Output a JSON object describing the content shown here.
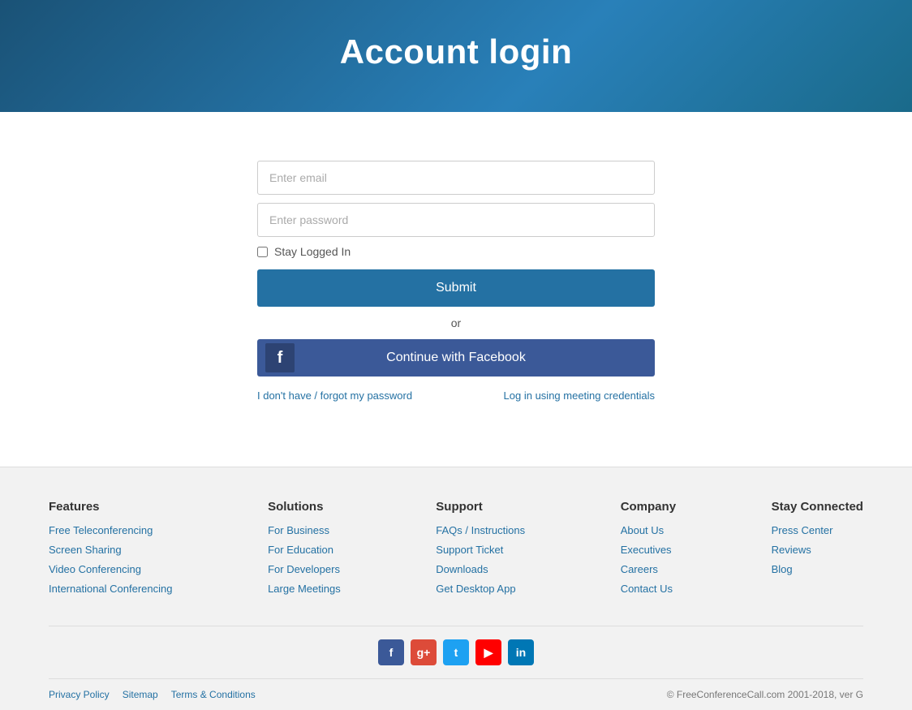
{
  "header": {
    "title": "Account login"
  },
  "form": {
    "email_placeholder": "Enter email",
    "password_placeholder": "Enter password",
    "stay_logged_in_label": "Stay Logged In",
    "submit_label": "Submit",
    "or_text": "or",
    "facebook_button_label": "Continue with Facebook",
    "forgot_password_link": "I don't have / forgot my password",
    "meeting_credentials_link": "Log in using meeting credentials"
  },
  "footer": {
    "columns": [
      {
        "heading": "Features",
        "links": [
          "Free Teleconferencing",
          "Screen Sharing",
          "Video Conferencing",
          "International Conferencing"
        ]
      },
      {
        "heading": "Solutions",
        "links": [
          "For Business",
          "For Education",
          "For Developers",
          "Large Meetings"
        ]
      },
      {
        "heading": "Support",
        "links": [
          "FAQs / Instructions",
          "Support Ticket",
          "Downloads",
          "Get Desktop App"
        ]
      },
      {
        "heading": "Company",
        "links": [
          "About Us",
          "Executives",
          "Careers",
          "Contact Us"
        ]
      },
      {
        "heading": "Stay Connected",
        "links": [
          "Press Center",
          "Reviews",
          "Blog"
        ]
      }
    ],
    "bottom": {
      "privacy_policy": "Privacy Policy",
      "sitemap": "Sitemap",
      "terms": "Terms & Conditions",
      "copyright": "© FreeConferenceCall.com 2001-2018, ver G"
    }
  }
}
